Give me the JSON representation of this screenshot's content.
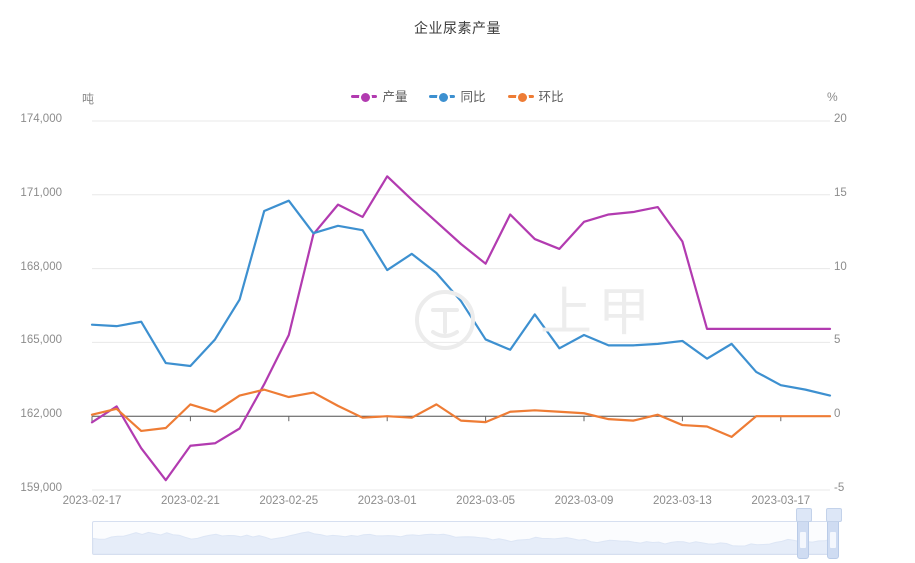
{
  "chart_data": {
    "type": "line",
    "title": "企业尿素产量",
    "xlabel": "",
    "ylabel": "吨",
    "y2label": "%",
    "grid": true,
    "legend_position": "top-center",
    "watermark": "上甲",
    "x": [
      "2023-02-17",
      "2023-02-18",
      "2023-02-19",
      "2023-02-20",
      "2023-02-21",
      "2023-02-22",
      "2023-02-23",
      "2023-02-24",
      "2023-02-25",
      "2023-02-26",
      "2023-02-27",
      "2023-02-28",
      "2023-03-01",
      "2023-03-02",
      "2023-03-03",
      "2023-03-04",
      "2023-03-05",
      "2023-03-06",
      "2023-03-07",
      "2023-03-08",
      "2023-03-09",
      "2023-03-10",
      "2023-03-11",
      "2023-03-12",
      "2023-03-13",
      "2023-03-14",
      "2023-03-15",
      "2023-03-16",
      "2023-03-17",
      "2023-03-18",
      "2023-03-19"
    ],
    "x_tick_labels": [
      "2023-02-17",
      "2023-02-21",
      "2023-02-25",
      "2023-03-01",
      "2023-03-05",
      "2023-03-09",
      "2023-03-13",
      "2023-03-17"
    ],
    "y_tick_labels": [
      "174,000",
      "171,000",
      "168,000",
      "165,000",
      "162,000",
      "159,000"
    ],
    "y2_tick_labels": [
      "20",
      "15",
      "10",
      "5",
      "0",
      "-5"
    ],
    "ylim": [
      159000,
      174000
    ],
    "y2lim": [
      -5,
      20
    ],
    "series": [
      {
        "name": "产量",
        "axis": "left",
        "color": "#b23bb0",
        "values": [
          161750,
          162400,
          160700,
          159400,
          160800,
          160900,
          161500,
          163300,
          165300,
          169400,
          170600,
          170100,
          171750,
          170800,
          169900,
          169000,
          168200,
          170200,
          169200,
          168800,
          169900,
          170200,
          170300,
          170500,
          169100,
          165550,
          165550,
          165550,
          165550,
          165550,
          165550
        ]
      },
      {
        "name": "同比",
        "axis": "right",
        "color": "#3d90d0",
        "values": [
          6.2,
          6.1,
          6.4,
          3.6,
          3.4,
          5.2,
          7.9,
          13.9,
          14.6,
          12.4,
          12.9,
          12.6,
          9.9,
          11.0,
          9.7,
          7.8,
          5.2,
          4.5,
          6.9,
          4.6,
          5.5,
          4.8,
          4.8,
          4.9,
          5.1,
          3.9,
          4.9,
          3.0,
          2.1,
          1.8,
          1.4
        ]
      },
      {
        "name": "环比",
        "axis": "right",
        "color": "#ee7c35",
        "values": [
          0.1,
          0.5,
          -1.0,
          -0.8,
          0.8,
          0.3,
          1.4,
          1.8,
          1.3,
          1.6,
          0.7,
          -0.1,
          0.0,
          -0.1,
          0.8,
          -0.3,
          -0.4,
          0.3,
          0.4,
          0.3,
          0.2,
          -0.2,
          -0.3,
          0.1,
          -0.6,
          -0.7,
          -1.4,
          0.0,
          0.0,
          0.0,
          0.0
        ]
      }
    ]
  },
  "datazoom": {
    "start_percent": 96,
    "end_percent": 100
  }
}
